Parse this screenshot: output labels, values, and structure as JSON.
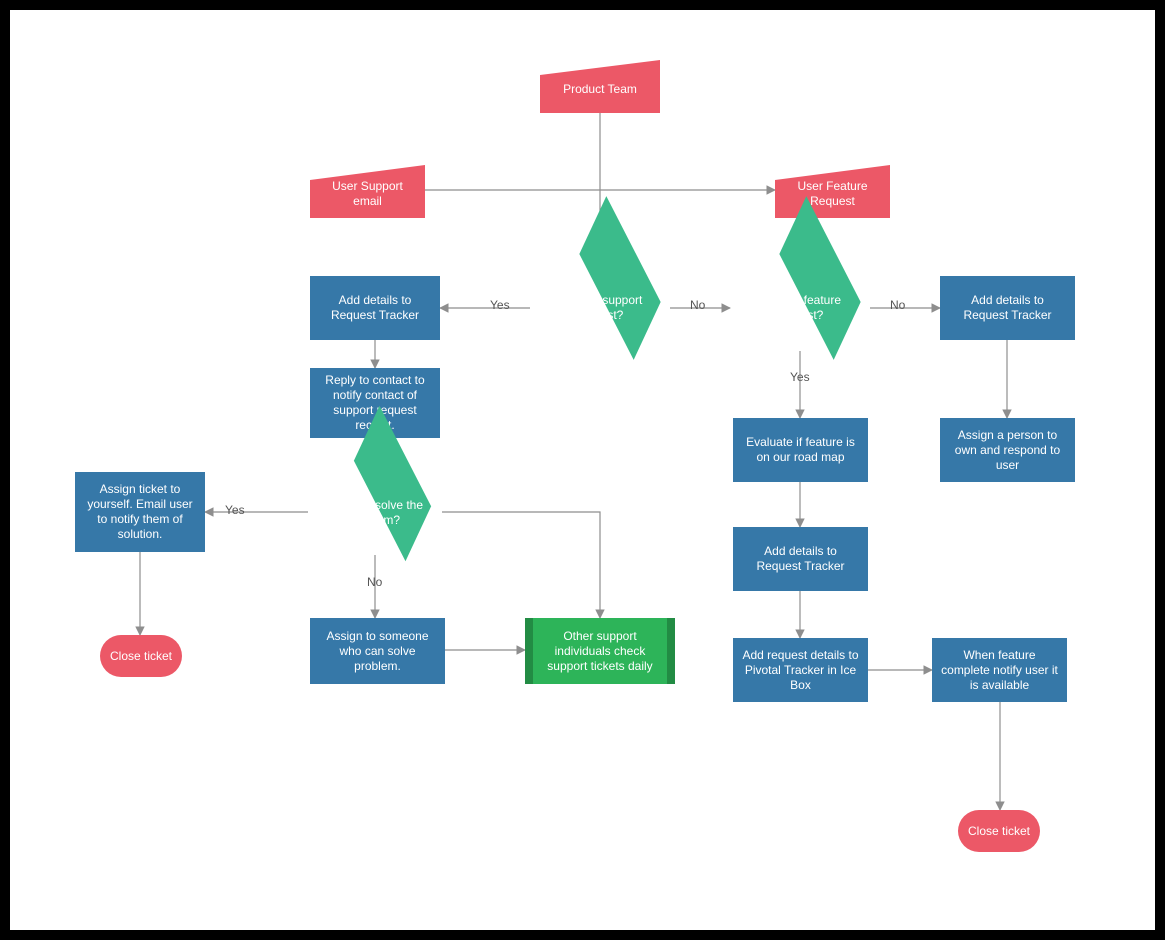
{
  "colors": {
    "process": "#3678a8",
    "decision": "#3bbb8b",
    "terminator": "#ec5867",
    "input": "#ec5867",
    "subprocess": "#2db459",
    "subprocess_border": "#228c44",
    "edge": "#8e8e8e",
    "frame_border": "#000000"
  },
  "nodes": {
    "product_team": "Product Team",
    "user_support_email": "User Support email",
    "user_feature_request": "User Feature Request",
    "is_support_request": "Is this a support request?",
    "is_feature_request": "Is this a feature request?",
    "add_details_rt_left": "Add details to Request Tracker",
    "reply_contact": "Reply to contact to notify contact of support request receipt.",
    "can_solve": "Can you solve the problem?",
    "assign_self": "Assign ticket to yourself. Email user to notify them of solution.",
    "close_ticket_left": "Close ticket",
    "assign_someone": "Assign to someone who can solve problem.",
    "other_support": "Other support individuals check support tickets daily",
    "evaluate_roadmap": "Evaluate if feature is on our road map",
    "add_details_rt_mid": "Add details to Request Tracker",
    "add_pivotal": "Add request details to Pivotal Tracker in Ice Box",
    "notify_available": "When feature complete notify user it is available",
    "close_ticket_right": "Close ticket",
    "add_details_rt_right": "Add details to Request Tracker",
    "assign_owner": "Assign a person to own and respond to user"
  },
  "edge_labels": {
    "yes": "Yes",
    "no": "No"
  }
}
